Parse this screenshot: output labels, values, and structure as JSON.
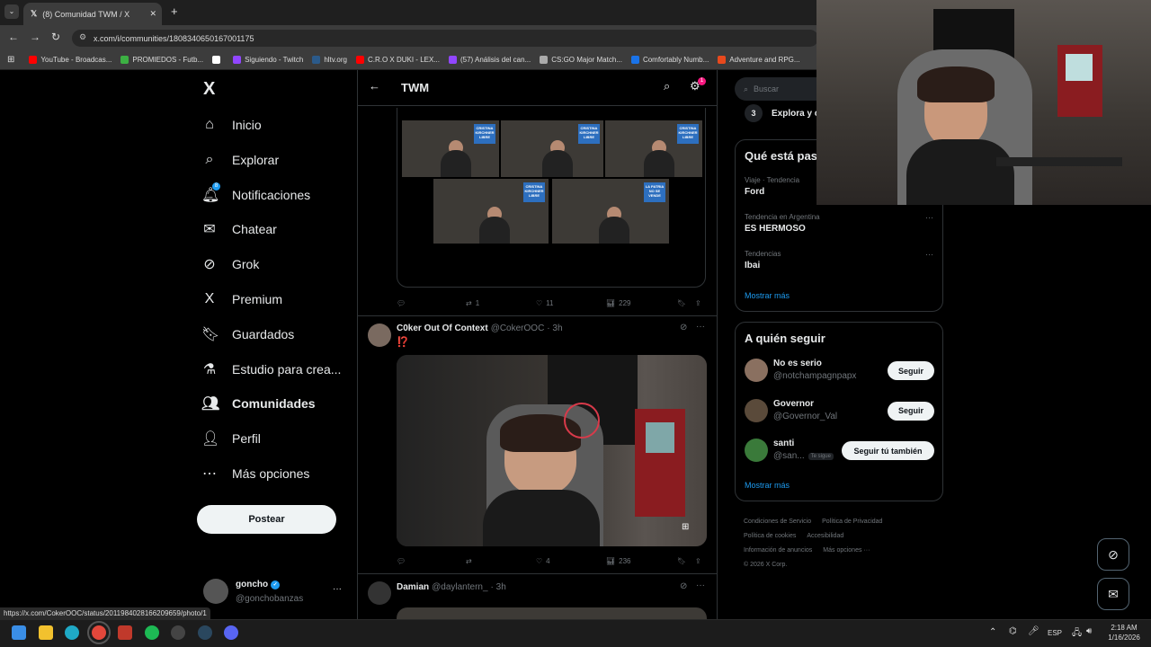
{
  "browser": {
    "tab_title": "(8) Comunidad TWM / X",
    "url": "x.com/i/communities/1808340650167001175",
    "new_tab": "+",
    "bookmarks": [
      {
        "label": "YouTube - Broadcas...",
        "color": "#ff0000"
      },
      {
        "label": "PROMIEDOS - Futb...",
        "color": "#3cb043"
      },
      {
        "label": "",
        "color": "#ffffff"
      },
      {
        "label": "Siguiendo - Twitch",
        "color": "#9146ff"
      },
      {
        "label": "hltv.org",
        "color": "#2b5a8a"
      },
      {
        "label": "C.R.O X DUKI - LEX...",
        "color": "#ff0000"
      },
      {
        "label": "(57) Análisis del can...",
        "color": "#9146ff"
      },
      {
        "label": "CS:GO Major Match...",
        "color": "#aaaaaa"
      },
      {
        "label": "Comfortably Numb...",
        "color": "#1a73e8"
      },
      {
        "label": "Adventure and RPG...",
        "color": "#e8491d"
      }
    ],
    "status_url": "https://x.com/CokerOOC/status/2011984028166209659/photo/1"
  },
  "nav": {
    "logo": "X",
    "items": [
      {
        "label": "Inicio",
        "icon": "home-icon",
        "glyph": "⌂"
      },
      {
        "label": "Explorar",
        "icon": "search-icon",
        "glyph": "⌕"
      },
      {
        "label": "Notificaciones",
        "icon": "bell-icon",
        "glyph": "🔔︎"
      },
      {
        "label": "Chatear",
        "icon": "mail-icon",
        "glyph": "✉"
      },
      {
        "label": "Grok",
        "icon": "grok-icon",
        "glyph": "⊘"
      },
      {
        "label": "Premium",
        "icon": "x-premium-icon",
        "glyph": "X"
      },
      {
        "label": "Guardados",
        "icon": "bookmark-icon",
        "glyph": "🔖︎"
      },
      {
        "label": "Estudio para crea...",
        "icon": "flask-icon",
        "glyph": "⚗"
      },
      {
        "label": "Comunidades",
        "icon": "communities-icon",
        "glyph": "👥︎"
      },
      {
        "label": "Perfil",
        "icon": "person-icon",
        "glyph": "👤︎"
      },
      {
        "label": "Más opciones",
        "icon": "more-circle-icon",
        "glyph": "⋯"
      }
    ],
    "notif_badge": "8",
    "post_button": "Postear",
    "account": {
      "name": "goncho",
      "handle": "@gonchobanzas",
      "more": "···"
    }
  },
  "header": {
    "title": "TWM",
    "settings_badge": "1"
  },
  "post1": {
    "banner": "CRISTINA KIRCHNER LIBRE",
    "banner_alt": "LA PATRIA NO SE VENDE",
    "stats": {
      "replies": "",
      "reposts": "1",
      "likes": "11",
      "views": "229"
    }
  },
  "post2": {
    "author": "C0ker Out Of Context",
    "handle": "@CokerOOC",
    "time": "· 3h",
    "text": "⁉️",
    "stats": {
      "replies": "",
      "reposts": "",
      "likes": "4",
      "views": "236"
    }
  },
  "post3": {
    "author": "Damian",
    "handle": "@daylantern_",
    "time": "· 3h"
  },
  "right": {
    "search_placeholder": "Buscar",
    "explore_num": "3",
    "explore_text": "Explora y c",
    "trends_title": "Qué está pas",
    "trends": [
      {
        "meta": "Viaje · Tendencia",
        "name": "Ford"
      },
      {
        "meta": "Tendencia en Argentina",
        "name": "ES HERMOSO"
      },
      {
        "meta": "Tendencias",
        "name": "Ibai"
      }
    ],
    "show_more": "Mostrar más",
    "who_title": "A quién seguir",
    "suggestions": [
      {
        "name": "No es serio",
        "handle": "@notchampagnpapx",
        "button": "Seguir",
        "tag": ""
      },
      {
        "name": "Governor",
        "handle": "@Governor_Val",
        "button": "Seguir",
        "tag": ""
      },
      {
        "name": "santi",
        "handle": "@san...",
        "button": "Seguir tú también",
        "tag": "Te sigue"
      }
    ],
    "show_more2": "Mostrar más",
    "footer": [
      "Condiciones de Servicio",
      "Política de Privacidad",
      "Política de cookies",
      "Accesibilidad",
      "Información de anuncios",
      "Más opciones ···",
      "© 2026 X Corp."
    ]
  },
  "taskbar": {
    "lang": "ESP",
    "time": "2:18 AM",
    "date": "1/16/2026"
  },
  "colors": {
    "accent": "#1d9bf0",
    "bg": "#000000",
    "border": "#2f3336",
    "muted": "#71767b"
  }
}
